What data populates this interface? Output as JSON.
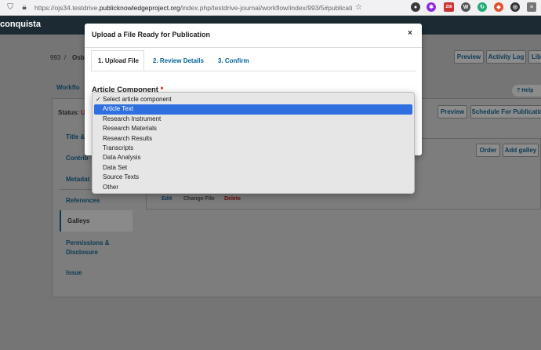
{
  "browser": {
    "url_prefix": "https://ojs34.testdrive.",
    "url_domain": "publicknowledgeproject.org",
    "url_suffix": "/index.php/testdrive-journal/workflow/index/993/5#publication/galleys",
    "ext_badge": "256"
  },
  "app": {
    "brand": "conquista"
  },
  "submission": {
    "id": "993",
    "sep": "/",
    "author": "Osbo",
    "buttons": {
      "preview": "Preview",
      "activity_log": "Activity Log",
      "library": "Lib"
    }
  },
  "workflow_tab": "Workflo",
  "help_label": "Help",
  "status": {
    "label": "Status:",
    "value": "U"
  },
  "publication_buttons": {
    "preview": "Preview",
    "schedule": "Schedule For Publicatio"
  },
  "sidebar": [
    {
      "label": "Title &"
    },
    {
      "label": "Contrib"
    },
    {
      "label": "Metadat"
    },
    {
      "label": "References"
    },
    {
      "label": "Galleys"
    },
    {
      "label": "Permissions & Disclosure"
    },
    {
      "label": "Issue"
    }
  ],
  "galleys": {
    "order": "Order",
    "add_galley": "Add galley",
    "row_actions": {
      "edit": "Edit",
      "change_file": "Change File",
      "delete": "Delete"
    }
  },
  "modal": {
    "title": "Upload a File Ready for Publication",
    "close": "×",
    "tabs": [
      "1. Upload File",
      "2. Review Details",
      "3. Confirm"
    ],
    "field_label": "Article Component",
    "required_mark": "*"
  },
  "dropdown": {
    "options": [
      "Select article component",
      "Article Text",
      "Research Instrument",
      "Research Materials",
      "Research Results",
      "Transcripts",
      "Data Analysis",
      "Data Set",
      "Source Texts",
      "Other"
    ],
    "checked_index": 0,
    "highlighted_index": 1
  },
  "colors": {
    "accent": "#006798",
    "highlight": "#2f6fe0",
    "required": "#d00000",
    "header": "#1c2b33"
  }
}
